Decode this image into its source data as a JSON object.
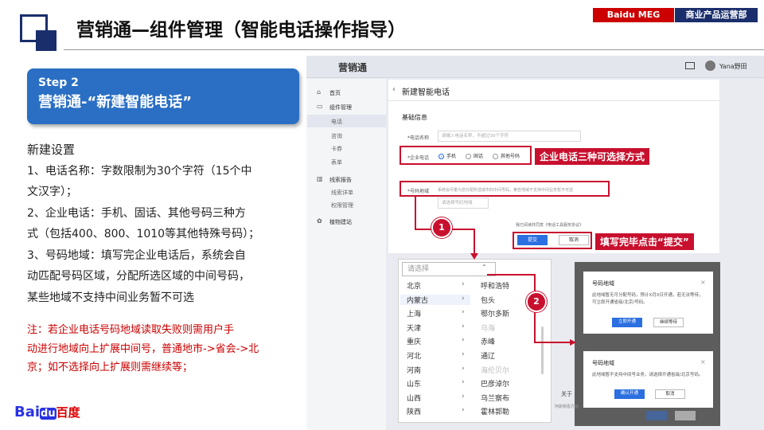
{
  "header": {
    "title": "营销通—组件管理（智能电话操作指导）",
    "tag_left": "Baidu MEG",
    "tag_right": "商业产品运营部"
  },
  "step": {
    "label": "Step 2",
    "title": "营销通-“新建智能电话”"
  },
  "description": {
    "heading": "新建设置",
    "lines": [
      "1、电话名称：字数限制为30个字符（15个中",
      "文汉字）；",
      "2、企业电话：手机、固话、其他号码三种方",
      "式（包括400、800、1010等其他特殊号码）；",
      "3、号码地域：填写完企业电话后，系统会自",
      "动匹配号码区域，分配所选区域的中间号码，",
      "某些地域不支持中间业务暂不可选"
    ],
    "note_lines": [
      "注：若企业电话号码地域读取失败则需用户手",
      "动进行地域向上扩展中间号，普通地市->省会->北",
      "京；如不选择向上扩展则需继续等；"
    ]
  },
  "logo": {
    "bai": "Bai",
    "du": "du",
    "cn": "百度"
  },
  "app": {
    "name": "营销通",
    "user": "Yana野田",
    "sidebar": [
      {
        "label": "首页",
        "icon": "home-icon"
      },
      {
        "label": "组件管理",
        "icon": "folder-icon"
      },
      {
        "label": "电话",
        "sub": true,
        "active": true
      },
      {
        "label": "咨询",
        "sub": true
      },
      {
        "label": "卡券",
        "sub": true
      },
      {
        "label": "表单",
        "sub": true
      },
      {
        "label": "线索报告",
        "icon": "chart-icon"
      },
      {
        "label": "线索详单",
        "sub": true
      },
      {
        "label": "权限管理",
        "sub": true
      },
      {
        "label": "植物建站",
        "icon": "gear-icon"
      }
    ],
    "form": {
      "back": "‹",
      "title": "新建智能电话",
      "section": "基础信息",
      "name_label": "*电话名称",
      "name_placeholder": "请输入电话名称，不超过30个字符",
      "phone_label": "*企业电话",
      "radio_mobile": "手机",
      "radio_fixed": "固话",
      "radio_other": "其他号码",
      "region_label": "*号码地域",
      "region_hint": "系统会尽量为您分配所选城市的中间号码，某些地域不支持中间业务暂不可选",
      "region_select_placeholder": "请选择号码地域",
      "agree": "我已阅读并同意《电话工具服务协议》",
      "submit": "提交",
      "cancel": "取消"
    },
    "dropdown": {
      "placeholder": "请选择",
      "provinces": [
        "北京",
        "内蒙古",
        "上海",
        "天津",
        "重庆",
        "河北",
        "河南",
        "山东",
        "山西",
        "陕西"
      ],
      "cities": [
        {
          "name": "呼和浩特"
        },
        {
          "name": "包头"
        },
        {
          "name": "鄂尔多斯"
        },
        {
          "name": "乌海",
          "disabled": true
        },
        {
          "name": "赤峰"
        },
        {
          "name": "通辽"
        },
        {
          "name": "海伦贝尔",
          "disabled": true
        },
        {
          "name": "巴彦淖尔"
        },
        {
          "name": "乌兰察布"
        },
        {
          "name": "霍林郭勒"
        }
      ]
    },
    "dialog1": {
      "title": "号码地域",
      "text": "此地域暂无可分配号码，预计X月X日开通，若无法等待，可立即开通省级/北京/号码。",
      "primary": "立即开通",
      "secondary": "继续等待"
    },
    "dialog2": {
      "title": "号码地域",
      "text": "此地域暂不支持中间号业务，请选择开通省级/北京号码。",
      "primary": "确认开通",
      "secondary": "取消"
    },
    "peek_text": "关于",
    "peek_text2": "阿斯顿看方面"
  },
  "callouts": {
    "phone": "企业电话三种可选择方式",
    "submit": "填写完毕点击“提交”",
    "step1": "1",
    "step2": "2"
  }
}
